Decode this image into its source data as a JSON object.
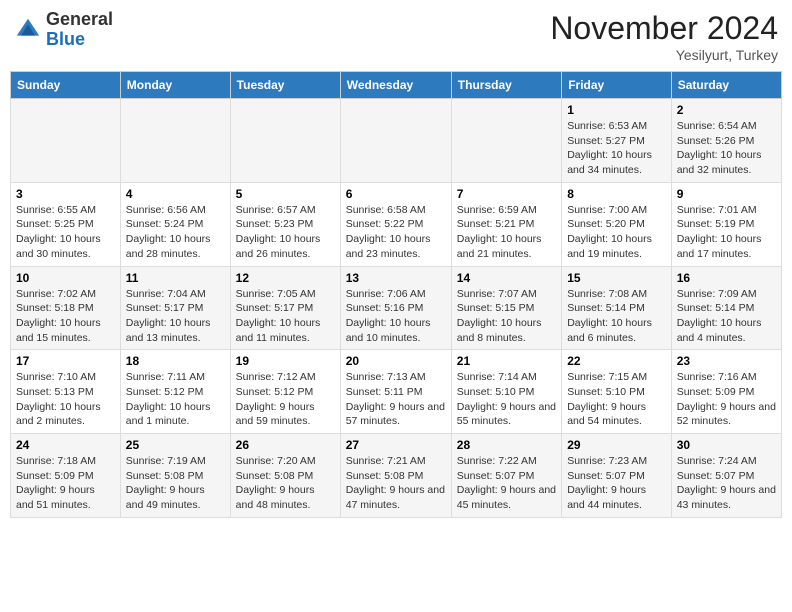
{
  "header": {
    "logo_general": "General",
    "logo_blue": "Blue",
    "month_title": "November 2024",
    "location": "Yesilyurt, Turkey"
  },
  "days_of_week": [
    "Sunday",
    "Monday",
    "Tuesday",
    "Wednesday",
    "Thursday",
    "Friday",
    "Saturday"
  ],
  "weeks": [
    [
      {
        "day": "",
        "info": ""
      },
      {
        "day": "",
        "info": ""
      },
      {
        "day": "",
        "info": ""
      },
      {
        "day": "",
        "info": ""
      },
      {
        "day": "",
        "info": ""
      },
      {
        "day": "1",
        "info": "Sunrise: 6:53 AM\nSunset: 5:27 PM\nDaylight: 10 hours and 34 minutes."
      },
      {
        "day": "2",
        "info": "Sunrise: 6:54 AM\nSunset: 5:26 PM\nDaylight: 10 hours and 32 minutes."
      }
    ],
    [
      {
        "day": "3",
        "info": "Sunrise: 6:55 AM\nSunset: 5:25 PM\nDaylight: 10 hours and 30 minutes."
      },
      {
        "day": "4",
        "info": "Sunrise: 6:56 AM\nSunset: 5:24 PM\nDaylight: 10 hours and 28 minutes."
      },
      {
        "day": "5",
        "info": "Sunrise: 6:57 AM\nSunset: 5:23 PM\nDaylight: 10 hours and 26 minutes."
      },
      {
        "day": "6",
        "info": "Sunrise: 6:58 AM\nSunset: 5:22 PM\nDaylight: 10 hours and 23 minutes."
      },
      {
        "day": "7",
        "info": "Sunrise: 6:59 AM\nSunset: 5:21 PM\nDaylight: 10 hours and 21 minutes."
      },
      {
        "day": "8",
        "info": "Sunrise: 7:00 AM\nSunset: 5:20 PM\nDaylight: 10 hours and 19 minutes."
      },
      {
        "day": "9",
        "info": "Sunrise: 7:01 AM\nSunset: 5:19 PM\nDaylight: 10 hours and 17 minutes."
      }
    ],
    [
      {
        "day": "10",
        "info": "Sunrise: 7:02 AM\nSunset: 5:18 PM\nDaylight: 10 hours and 15 minutes."
      },
      {
        "day": "11",
        "info": "Sunrise: 7:04 AM\nSunset: 5:17 PM\nDaylight: 10 hours and 13 minutes."
      },
      {
        "day": "12",
        "info": "Sunrise: 7:05 AM\nSunset: 5:17 PM\nDaylight: 10 hours and 11 minutes."
      },
      {
        "day": "13",
        "info": "Sunrise: 7:06 AM\nSunset: 5:16 PM\nDaylight: 10 hours and 10 minutes."
      },
      {
        "day": "14",
        "info": "Sunrise: 7:07 AM\nSunset: 5:15 PM\nDaylight: 10 hours and 8 minutes."
      },
      {
        "day": "15",
        "info": "Sunrise: 7:08 AM\nSunset: 5:14 PM\nDaylight: 10 hours and 6 minutes."
      },
      {
        "day": "16",
        "info": "Sunrise: 7:09 AM\nSunset: 5:14 PM\nDaylight: 10 hours and 4 minutes."
      }
    ],
    [
      {
        "day": "17",
        "info": "Sunrise: 7:10 AM\nSunset: 5:13 PM\nDaylight: 10 hours and 2 minutes."
      },
      {
        "day": "18",
        "info": "Sunrise: 7:11 AM\nSunset: 5:12 PM\nDaylight: 10 hours and 1 minute."
      },
      {
        "day": "19",
        "info": "Sunrise: 7:12 AM\nSunset: 5:12 PM\nDaylight: 9 hours and 59 minutes."
      },
      {
        "day": "20",
        "info": "Sunrise: 7:13 AM\nSunset: 5:11 PM\nDaylight: 9 hours and 57 minutes."
      },
      {
        "day": "21",
        "info": "Sunrise: 7:14 AM\nSunset: 5:10 PM\nDaylight: 9 hours and 55 minutes."
      },
      {
        "day": "22",
        "info": "Sunrise: 7:15 AM\nSunset: 5:10 PM\nDaylight: 9 hours and 54 minutes."
      },
      {
        "day": "23",
        "info": "Sunrise: 7:16 AM\nSunset: 5:09 PM\nDaylight: 9 hours and 52 minutes."
      }
    ],
    [
      {
        "day": "24",
        "info": "Sunrise: 7:18 AM\nSunset: 5:09 PM\nDaylight: 9 hours and 51 minutes."
      },
      {
        "day": "25",
        "info": "Sunrise: 7:19 AM\nSunset: 5:08 PM\nDaylight: 9 hours and 49 minutes."
      },
      {
        "day": "26",
        "info": "Sunrise: 7:20 AM\nSunset: 5:08 PM\nDaylight: 9 hours and 48 minutes."
      },
      {
        "day": "27",
        "info": "Sunrise: 7:21 AM\nSunset: 5:08 PM\nDaylight: 9 hours and 47 minutes."
      },
      {
        "day": "28",
        "info": "Sunrise: 7:22 AM\nSunset: 5:07 PM\nDaylight: 9 hours and 45 minutes."
      },
      {
        "day": "29",
        "info": "Sunrise: 7:23 AM\nSunset: 5:07 PM\nDaylight: 9 hours and 44 minutes."
      },
      {
        "day": "30",
        "info": "Sunrise: 7:24 AM\nSunset: 5:07 PM\nDaylight: 9 hours and 43 minutes."
      }
    ]
  ]
}
